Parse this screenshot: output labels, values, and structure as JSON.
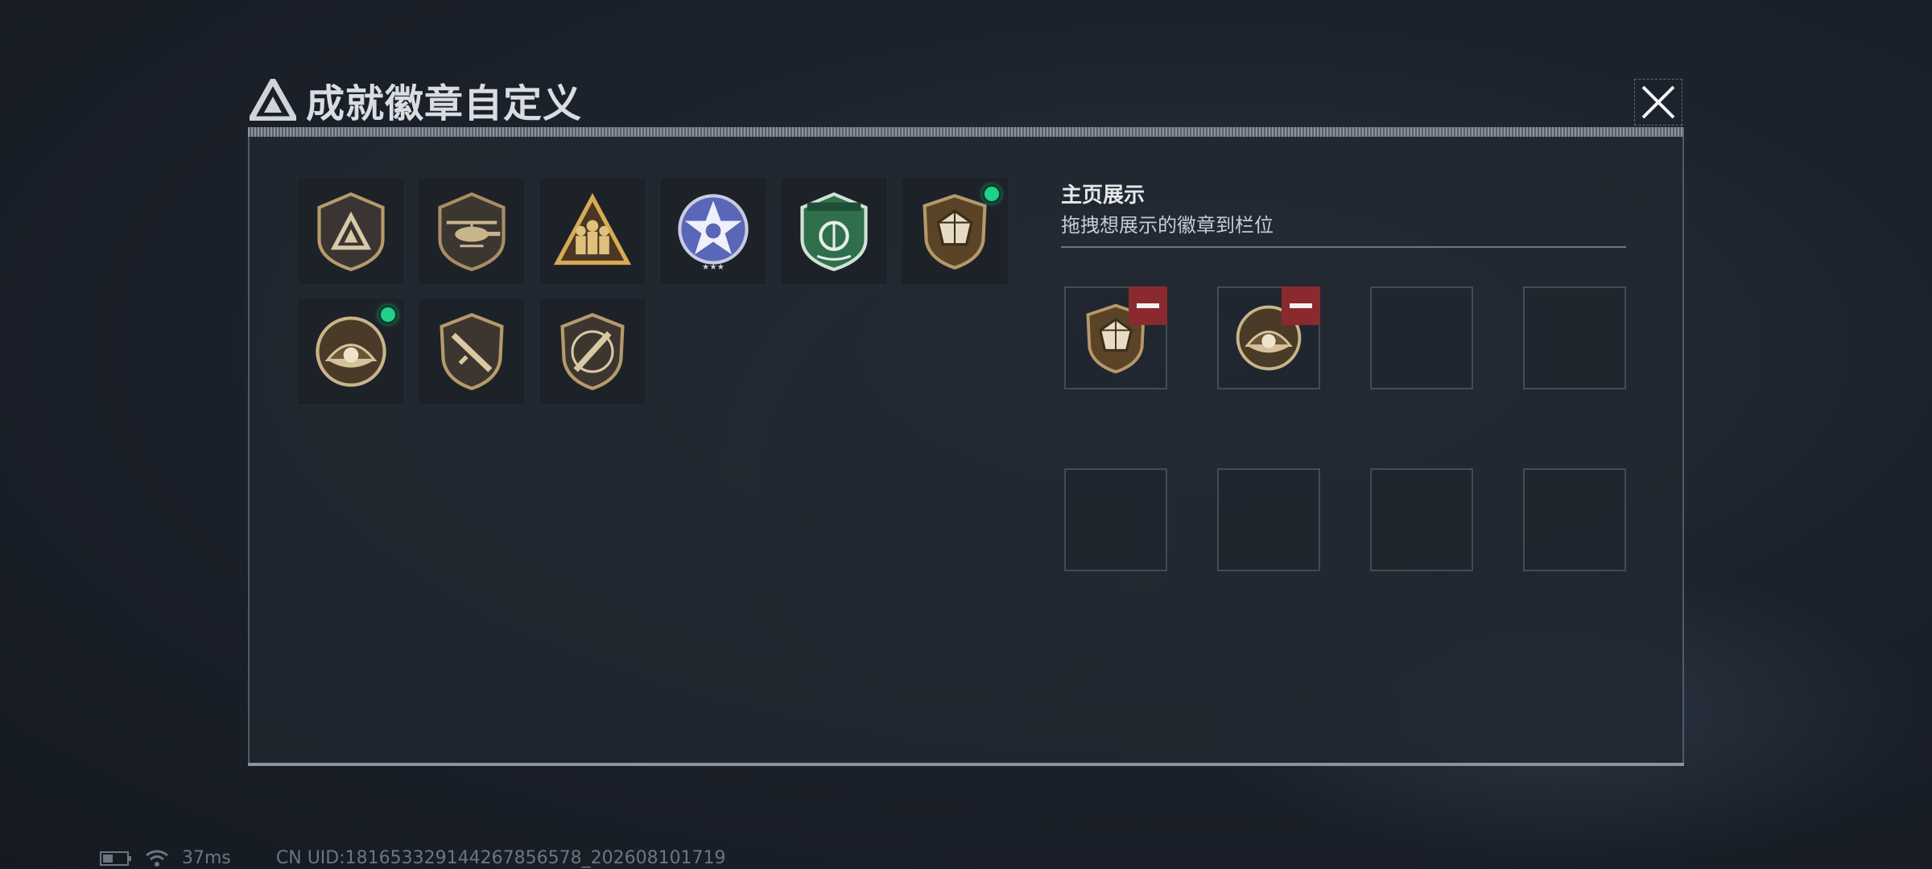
{
  "window": {
    "title": "成就徽章自定义",
    "close_icon": "close-icon"
  },
  "badges": [
    {
      "name": "delta-emblem",
      "icon": "delta-triangle-shield-icon",
      "new": false
    },
    {
      "name": "helicopter-emblem",
      "icon": "helicopter-shield-icon",
      "new": false
    },
    {
      "name": "squad-emblem",
      "icon": "soldiers-triangle-icon",
      "new": false
    },
    {
      "name": "star-emblem",
      "icon": "blue-star-badge-icon",
      "new": false
    },
    {
      "name": "green-emblem",
      "icon": "green-shield-icon",
      "new": false
    },
    {
      "name": "gem-emblem",
      "icon": "gem-shield-icon",
      "new": true
    },
    {
      "name": "pearl-emblem",
      "icon": "pearl-shell-badge-icon",
      "new": true
    },
    {
      "name": "rifle-emblem",
      "icon": "rifle-shield-icon",
      "new": false
    },
    {
      "name": "knife-emblem",
      "icon": "knife-shield-icon",
      "new": false
    }
  ],
  "showcase": {
    "title": "主页展示",
    "subtitle": "拖拽想展示的徽章到栏位",
    "slots": [
      {
        "icon": "gem-shield-icon",
        "removable": true
      },
      {
        "icon": "pearl-shell-badge-icon",
        "removable": true
      },
      {
        "icon": "",
        "removable": false
      },
      {
        "icon": "",
        "removable": false
      },
      {
        "icon": "",
        "removable": false
      },
      {
        "icon": "",
        "removable": false
      },
      {
        "icon": "",
        "removable": false
      },
      {
        "icon": "",
        "removable": false
      }
    ]
  },
  "status": {
    "battery_icon": "battery-icon",
    "wifi_icon": "wifi-icon",
    "ping": "37ms",
    "uid": "CN UID:18165332914426785657​8_202608101719"
  },
  "colors": {
    "accent_green": "#1fd18a",
    "remove_red": "#8a2a2e",
    "badge_gold": "#c8a874"
  }
}
